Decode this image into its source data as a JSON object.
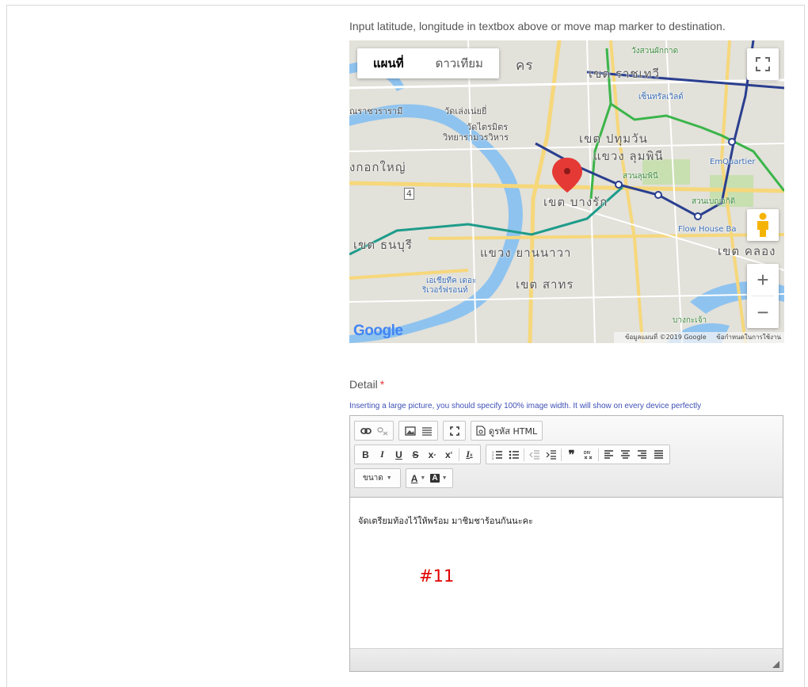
{
  "map": {
    "hint": "Input latitude, longitude in textbox above or move map marker to destination.",
    "types": [
      "แผนที่",
      "ดาวเทียม"
    ],
    "logo": "Google",
    "credits": [
      "ข้อมูลแผนที่ ©2019 Google",
      "ข้อกำหนดในการใช้งาน"
    ],
    "labels": {
      "l1": "วังสวนผักกาด",
      "l2": "เขต ราชเทวี",
      "l3": "เซ็นทรัลเวิลด์",
      "l4": "วัดเล่งเน่ยยี่",
      "l5": "ณราชวรารามี",
      "l6": "วัดไตรมิตร",
      "l7": "วิทยารามวรวิหาร",
      "l8": "เขต ปทุมวัน",
      "l9": "แขวง ลุมพินี",
      "l10": "งกอกใหญ่",
      "l11": "สวนลุมพินี",
      "l12": "EmQuartier",
      "l13": "เขต บางรัก",
      "l14": "สวนเบญจกิติ",
      "l15": "Flow House Ba",
      "l16": "เขต ธนบุรี",
      "l17": "แขวง ยานนาวา",
      "l18": "เขต คลอง",
      "l19": "เอเชียทีค เดอะ",
      "l20": "ริเวอร์ฟรอนท์",
      "l21": "เขต สาทร",
      "l22": "บางกะเจ้า",
      "l23": "คร",
      "l24": "4"
    }
  },
  "detail": {
    "label": "Detail",
    "required": "*",
    "note": "Inserting a large picture, you should specify 100% image width. It will show on every device perfectly"
  },
  "editor": {
    "source_label": "ดูรหัส HTML",
    "size_label": "ขนาด",
    "font_color_label": "A",
    "bg_color_label": "A",
    "content": "จัดเตรียมท้องไว้ให้พร้อม มาชิมชาร้อนกันนะคะ"
  },
  "tag": "#11",
  "colors": {
    "marker": "#e53935",
    "bts_green": "#3bb54a",
    "mrt_blue": "#2a3f8f",
    "river": "#7db5e6",
    "label_link": "#3f51b5"
  }
}
